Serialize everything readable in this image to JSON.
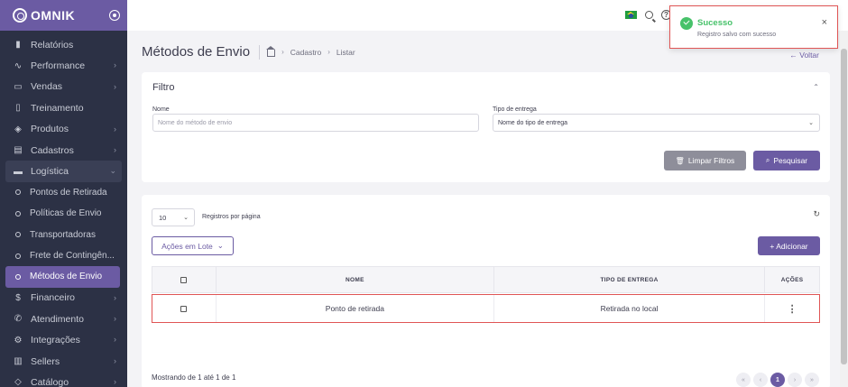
{
  "brand": {
    "name": "OMNIK"
  },
  "sidebar": {
    "items": [
      {
        "label": "Relatórios",
        "icon": "bar-chart-icon"
      },
      {
        "label": "Performance",
        "icon": "activity-icon"
      },
      {
        "label": "Vendas",
        "icon": "credit-card-icon"
      },
      {
        "label": "Treinamento",
        "icon": "book-icon"
      },
      {
        "label": "Produtos",
        "icon": "box-icon"
      },
      {
        "label": "Cadastros",
        "icon": "folder-icon"
      },
      {
        "label": "Logística",
        "icon": "truck-icon"
      }
    ],
    "logistica_sub": [
      {
        "label": "Pontos de Retirada"
      },
      {
        "label": "Políticas de Envio"
      },
      {
        "label": "Transportadoras"
      },
      {
        "label": "Frete de Contingên..."
      },
      {
        "label": "Métodos de Envio"
      }
    ],
    "items_after": [
      {
        "label": "Financeiro",
        "icon": "dollar-icon"
      },
      {
        "label": "Atendimento",
        "icon": "phone-icon"
      },
      {
        "label": "Integrações",
        "icon": "settings-icon"
      },
      {
        "label": "Sellers",
        "icon": "users-icon"
      },
      {
        "label": "Catálogo",
        "icon": "tag-icon"
      }
    ]
  },
  "toast": {
    "title": "Sucesso",
    "message": "Registro salvo com sucesso",
    "close": "×"
  },
  "header": {
    "title": "Métodos de Envio",
    "breadcrumb": [
      "Cadastro",
      "Listar"
    ],
    "back": "← Voltar"
  },
  "filter": {
    "title": "Filtro",
    "name_label": "Nome",
    "name_placeholder": "Nome do método de envio",
    "type_label": "Tipo de entrega",
    "type_value": "Nome do tipo de entrega",
    "clear_button": "Limpar Filtros",
    "search_button": "Pesquisar"
  },
  "list": {
    "per_page": "10",
    "per_page_label": "Registros por página",
    "bulk_actions": "Ações em Lote",
    "add_button": "+ Adicionar",
    "columns": [
      "NOME",
      "TIPO DE ENTREGA",
      "AÇÕES"
    ],
    "rows": [
      {
        "name": "Ponto de retirada",
        "type": "Retirada no local"
      }
    ],
    "showing": "Mostrando de 1 até 1 de 1",
    "current_page": "1"
  },
  "colors": {
    "accent": "#6b5ba3",
    "sidebar": "#2c3145",
    "success": "#47c26a",
    "highlight": "#e05555"
  }
}
